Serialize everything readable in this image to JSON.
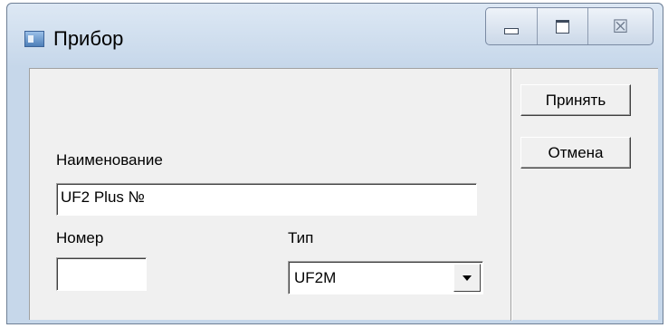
{
  "window": {
    "title": "Прибор",
    "icon": "app-window-icon",
    "controls": {
      "minimize_icon": "minimize-icon",
      "maximize_icon": "maximize-icon",
      "close_glyph": "☒"
    }
  },
  "buttons": {
    "accept_label": "Принять",
    "cancel_label": "Отмена"
  },
  "form": {
    "name_label": "Наименование",
    "name_value": "UF2 Plus №",
    "number_label": "Номер",
    "number_value": "",
    "type_label": "Тип",
    "type_value": "UF2M"
  }
}
